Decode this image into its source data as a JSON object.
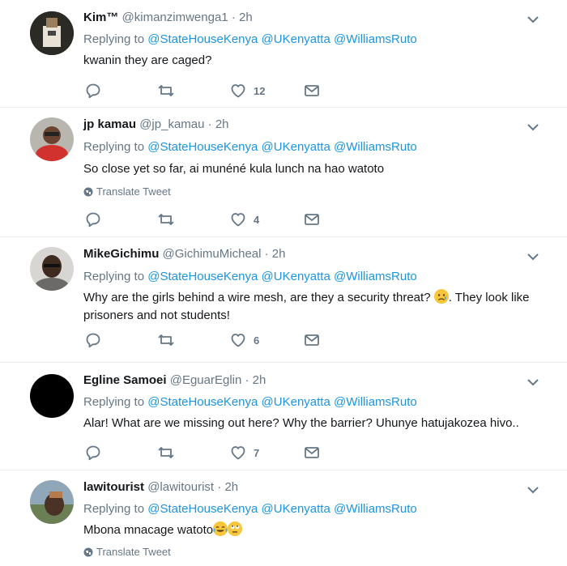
{
  "reply_label": "Replying to",
  "translate_label": "Translate Tweet",
  "tweets": [
    {
      "name": "Kim™",
      "handle": "@kimanzimwenga1",
      "time": "· 2h",
      "mentions": [
        "@StateHouseKenya",
        "@UKenyatta",
        "@WilliamsRuto"
      ],
      "text": "kwanin they are caged?",
      "likes": "12"
    },
    {
      "name": "jp kamau",
      "handle": "@jp_kamau",
      "time": "· 2h",
      "mentions": [
        "@StateHouseKenya",
        "@UKenyatta",
        "@WilliamsRuto"
      ],
      "text": "So close yet so far, ai munéné kula lunch na hao watoto",
      "likes": "4"
    },
    {
      "name": "MikeGichimu",
      "handle": "@GichimuMicheal",
      "time": "· 2h",
      "mentions": [
        "@StateHouseKenya",
        "@UKenyatta",
        "@WilliamsRuto"
      ],
      "text_a": "Why are the girls behind a wire mesh, are they a security threat?",
      "text_b": ". They look like prisoners and not students!",
      "likes": "6"
    },
    {
      "name": "Egline Samoei",
      "handle": "@EguarEglin",
      "time": "· 2h",
      "mentions": [
        "@StateHouseKenya",
        "@UKenyatta",
        "@WilliamsRuto"
      ],
      "text": "Alar! What are we missing out here? Why the barrier? Uhunye hatujakozea hivo..",
      "likes": "7"
    },
    {
      "name": "lawitourist",
      "handle": "@lawitourist",
      "time": "· 2h",
      "mentions": [
        "@StateHouseKenya",
        "@UKenyatta",
        "@WilliamsRuto"
      ],
      "text": "Mbona mnacage watoto",
      "likes": ""
    }
  ]
}
